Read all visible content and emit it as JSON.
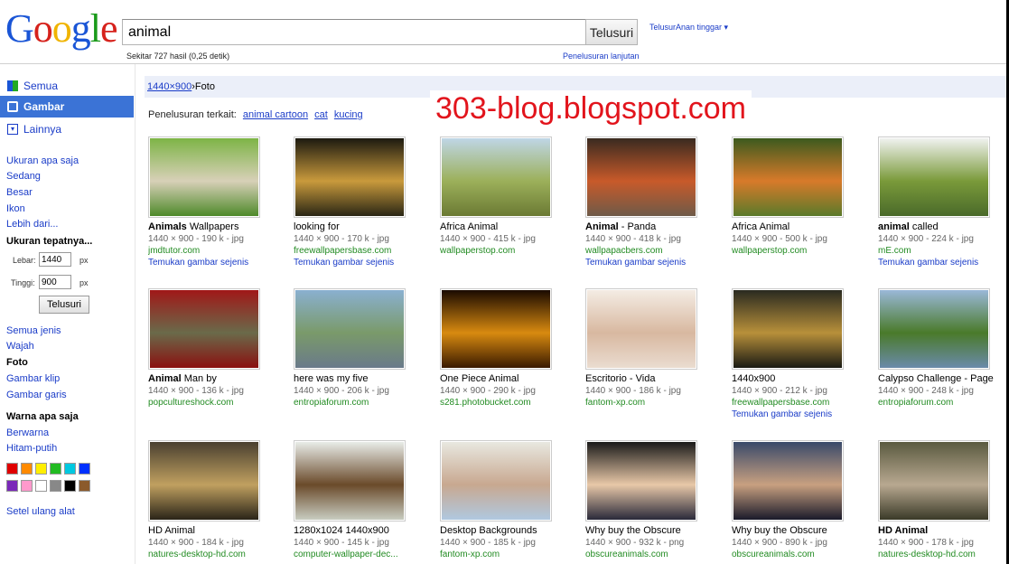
{
  "header": {
    "logo_letters": [
      {
        "ch": "G",
        "color": "#1a55d6"
      },
      {
        "ch": "o",
        "color": "#d6221c"
      },
      {
        "ch": "o",
        "color": "#f0b400"
      },
      {
        "ch": "g",
        "color": "#1a55d6"
      },
      {
        "ch": "l",
        "color": "#1a9a1a"
      },
      {
        "ch": "e",
        "color": "#d6221c"
      }
    ],
    "query": "animal",
    "search_button": "Telusuri",
    "adv_top": "TelusurAnan tinggar ▾",
    "result_stats": "Sekitar 727 hasil (0,25 detik)",
    "advanced_search": "Penelusuran lanjutan"
  },
  "sidebar": {
    "nav": [
      {
        "label": "Semua",
        "icon": "web-icon",
        "active": false
      },
      {
        "label": "Gambar",
        "icon": "images-icon",
        "active": true
      },
      {
        "label": "Lainnya",
        "icon": "more-icon",
        "active": false
      }
    ],
    "size_links": [
      "Ukuran apa saja",
      "Sedang",
      "Besar",
      "Ikon",
      "Lebih dari..."
    ],
    "exact_size_heading": "Ukuran tepatnya...",
    "width_label": "Lebar:",
    "width_value": "1440",
    "height_label": "Tinggi:",
    "height_value": "900",
    "px": "px",
    "filter_button": "Telusuri",
    "type_links": [
      "Semua jenis",
      "Wajah"
    ],
    "type_selected": "Foto",
    "type_links2": [
      "Gambar klip",
      "Gambar garis"
    ],
    "color_heading": "Warna apa saja",
    "color_links": [
      "Berwarna",
      "Hitam-putih"
    ],
    "swatches": [
      "#e00000",
      "#ff8a00",
      "#ffee00",
      "#22bb22",
      "#00c8e0",
      "#0030ff",
      "#7a28b8",
      "#ff99cc",
      "#ffffff",
      "#888888",
      "#000000",
      "#8b5a2b"
    ],
    "reset": "Setel ulang alat"
  },
  "breadcrumb": {
    "size": "1440×900",
    "sep": " › ",
    "type": "Foto"
  },
  "watermark": "303-blog.blogspot.com",
  "related": {
    "prefix": "Penelusuran terkait:",
    "links": [
      "animal cartoon",
      "cat",
      "kucing"
    ]
  },
  "results": [
    {
      "title_bold": "Animals",
      "title_rest": " Wallpapers",
      "meta": "1440 × 900 - 190 k - jpg",
      "site": "jmdtutor.com",
      "similar": "Temukan gambar sejenis",
      "colors": [
        "#7db446",
        "#d8d0b8",
        "#4e8a2a"
      ]
    },
    {
      "title_bold": "",
      "title_rest": "looking for",
      "meta": "1440 × 900 - 170 k - jpg",
      "site": "freewallpapersbase.com",
      "similar": "Temukan gambar sejenis",
      "colors": [
        "#1c1a10",
        "#c99a3c",
        "#2a2615"
      ]
    },
    {
      "title_bold": "",
      "title_rest": "Africa Animal",
      "meta": "1440 × 900 - 415 k - jpg",
      "site": "wallpaperstop.com",
      "similar": "",
      "colors": [
        "#bfd6e6",
        "#9cb05a",
        "#6b7a34"
      ]
    },
    {
      "title_bold": "Animal",
      "title_rest": " - Panda",
      "meta": "1440 × 900 - 418 k - jpg",
      "site": "wallpapacbers.com",
      "similar": "Temukan gambar sejenis",
      "colors": [
        "#3a2a20",
        "#c85a2a",
        "#6e5a48"
      ]
    },
    {
      "title_bold": "",
      "title_rest": "Africa Animal",
      "meta": "1440 × 900 - 500 k - jpg",
      "site": "wallpaperstop.com",
      "similar": "",
      "colors": [
        "#3c5a1e",
        "#d87a2a",
        "#5a7a2a"
      ]
    },
    {
      "title_bold": "animal",
      "title_rest": " called",
      "meta": "1440 × 900 - 224 k - jpg",
      "site": "mE.com",
      "similar": "Temukan gambar sejenis",
      "colors": [
        "#f0f2f0",
        "#7a9a3a",
        "#4a6a2a"
      ]
    },
    {
      "title_bold": "Animal",
      "title_rest": " Man by",
      "meta": "1440 × 900 - 136 k - jpg",
      "site": "popcultureshock.com",
      "similar": "",
      "colors": [
        "#a01818",
        "#6a6a4a",
        "#8a1010"
      ]
    },
    {
      "title_bold": "",
      "title_rest": "here was my five",
      "meta": "1440 × 900 - 206 k - jpg",
      "site": "entropiaforum.com",
      "similar": "",
      "colors": [
        "#8ab0d0",
        "#7a9a6a",
        "#6a7a8a"
      ]
    },
    {
      "title_bold": "",
      "title_rest": "One Piece Animal",
      "meta": "1440 × 900 - 290 k - jpg",
      "site": "s281.photobucket.com",
      "similar": "",
      "colors": [
        "#1a0a00",
        "#d88a10",
        "#3a1a00"
      ]
    },
    {
      "title_bold": "",
      "title_rest": "Escritorio - Vida",
      "meta": "1440 × 900 - 186 k - jpg",
      "site": "fantom-xp.com",
      "similar": "",
      "colors": [
        "#f4ece4",
        "#d8b8a0",
        "#eadcd0"
      ]
    },
    {
      "title_bold": "",
      "title_rest": "1440x900",
      "meta": "1440 × 900 - 212 k - jpg",
      "site": "freewallpapersbase.com",
      "similar": "Temukan gambar sejenis",
      "colors": [
        "#2a2a20",
        "#b8903a",
        "#1a1a14"
      ]
    },
    {
      "title_bold": "",
      "title_rest": "Calypso Challenge - Page",
      "meta": "1440 × 900 - 248 k - jpg",
      "site": "entropiaforum.com",
      "similar": "",
      "colors": [
        "#9ab8d8",
        "#4a7a2a",
        "#6a8aaa"
      ]
    },
    {
      "title_bold": "",
      "title_rest": "HD Animal",
      "meta": "1440 × 900 - 184 k - jpg",
      "site": "natures-desktop-hd.com",
      "similar": "",
      "colors": [
        "#4a4030",
        "#c0a060",
        "#2a2418"
      ]
    },
    {
      "title_bold": "",
      "title_rest": "1280x1024 1440x900",
      "meta": "1440 × 900 - 145 k - jpg",
      "site": "computer-wallpaper-dec...",
      "similar": "",
      "colors": [
        "#e8ece8",
        "#6a4a2a",
        "#c8ccc0"
      ]
    },
    {
      "title_bold": "",
      "title_rest": "Desktop Backgrounds",
      "meta": "1440 × 900 - 185 k - jpg",
      "site": "fantom-xp.com",
      "similar": "",
      "colors": [
        "#e8e8e0",
        "#c8a890",
        "#b0c8e0"
      ]
    },
    {
      "title_bold": "",
      "title_rest": "Why buy the Obscure",
      "meta": "1440 × 900 - 932 k - png",
      "site": "obscureanimals.com",
      "similar": "",
      "colors": [
        "#1a1a1a",
        "#e8c8a8",
        "#2a2a3a"
      ]
    },
    {
      "title_bold": "",
      "title_rest": "Why buy the Obscure",
      "meta": "1440 × 900 - 890 k - jpg",
      "site": "obscureanimals.com",
      "similar": "",
      "colors": [
        "#3a4a6a",
        "#c8a080",
        "#1a1a2a"
      ]
    },
    {
      "title_bold": "HD Animal",
      "title_rest": "",
      "meta": "1440 × 900 - 178 k - jpg",
      "site": "natures-desktop-hd.com",
      "similar": "",
      "colors": [
        "#5a5a40",
        "#b8a890",
        "#3a3a28"
      ]
    }
  ]
}
